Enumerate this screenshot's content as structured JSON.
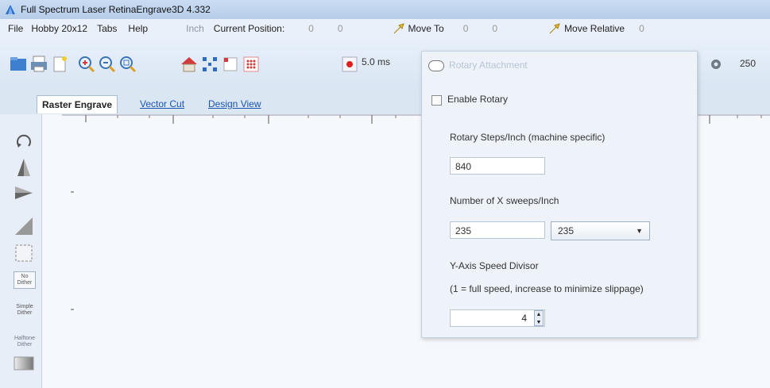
{
  "window": {
    "title": "Full Spectrum Laser RetinaEngrave3D 4.332"
  },
  "menu": {
    "items": [
      "File",
      "Hobby 20x12",
      "Tabs",
      "Help"
    ],
    "units": "Inch",
    "current_position_label": "Current Position:",
    "pos_x": "0",
    "pos_y": "0",
    "move_to_label": "Move To",
    "move_to_x": "0",
    "move_to_y": "0",
    "move_relative_label": "Move Relative",
    "move_relative_x": "0"
  },
  "toolbar": {
    "time_value": "5.0 ms",
    "right_value": "250",
    "icons": [
      "open-file-icon",
      "print-icon",
      "new-file-icon",
      "zoom-in-icon",
      "zoom-out-icon",
      "zoom-fit-icon",
      "home-icon",
      "grid-select-icon",
      "corner-icon",
      "dot-grid-icon",
      "record-icon",
      "gear-icon"
    ]
  },
  "tabs": [
    {
      "label": "Raster Engrave",
      "active": true
    },
    {
      "label": "Vector Cut",
      "active": false
    },
    {
      "label": "Design View",
      "active": false
    }
  ],
  "left_tools": {
    "no_dither": "No Dither",
    "simple_dither": "Simple Dither",
    "halftone": "Halftone Dither"
  },
  "rotary": {
    "title": "Rotary Attachment",
    "enable_label": "Enable Rotary",
    "enabled": false,
    "steps_label": "Rotary Steps/Inch (machine specific)",
    "steps_value": "840",
    "sweeps_label": "Number of X sweeps/Inch",
    "sweeps_value": "235",
    "sweeps_select": "235",
    "divisor_label": "Y-Axis Speed Divisor",
    "divisor_hint": "(1 = full speed, increase to minimize slippage)",
    "divisor_value": "4"
  },
  "colors": {
    "accent": "#1a55b0",
    "window_bg": "#dfe9f5",
    "canvas_bg": "#f5f8fc"
  }
}
